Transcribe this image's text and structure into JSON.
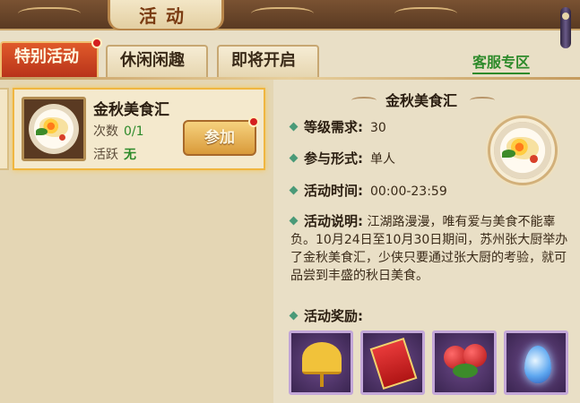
{
  "window": {
    "title": "活动"
  },
  "tabs": [
    {
      "label": "特别活动",
      "active": true,
      "has_alert": true
    },
    {
      "label": "休闲闲趣",
      "active": false,
      "has_alert": false
    },
    {
      "label": "即将开启",
      "active": false,
      "has_alert": false
    }
  ],
  "customer_service_link": "客服专区",
  "activity_card": {
    "name": "金秋美食汇",
    "count_label": "次数",
    "count_value": "0/1",
    "active_label": "活跃",
    "active_value": "无",
    "join_label": "参加",
    "icon": "food-plate-icon"
  },
  "detail": {
    "title": "金秋美食汇",
    "level_label": "等级需求:",
    "level_value": "30",
    "mode_label": "参与形式:",
    "mode_value": "单人",
    "time_label": "活动时间:",
    "time_value": "00:00-23:59",
    "desc_label": "活动说明:",
    "desc_text": "江湖路漫漫，唯有爱与美食不能辜负。10月24日至10月30日期间，苏州张大厨举办了金秋美食汇，少侠只要通过张大厨的考验，就可品尝到丰盛的秋日美食。",
    "rewards_label": "活动奖励:"
  },
  "rewards": [
    {
      "icon": "ginkgo-leaf-icon"
    },
    {
      "icon": "red-envelope-icon"
    },
    {
      "icon": "red-berries-icon"
    },
    {
      "icon": "blue-crystal-icon"
    }
  ],
  "colors": {
    "active_tab": "#c8401f",
    "link_green": "#2d8a2a",
    "card_highlight": "#f0b640",
    "alert_red": "#d41f1f"
  }
}
